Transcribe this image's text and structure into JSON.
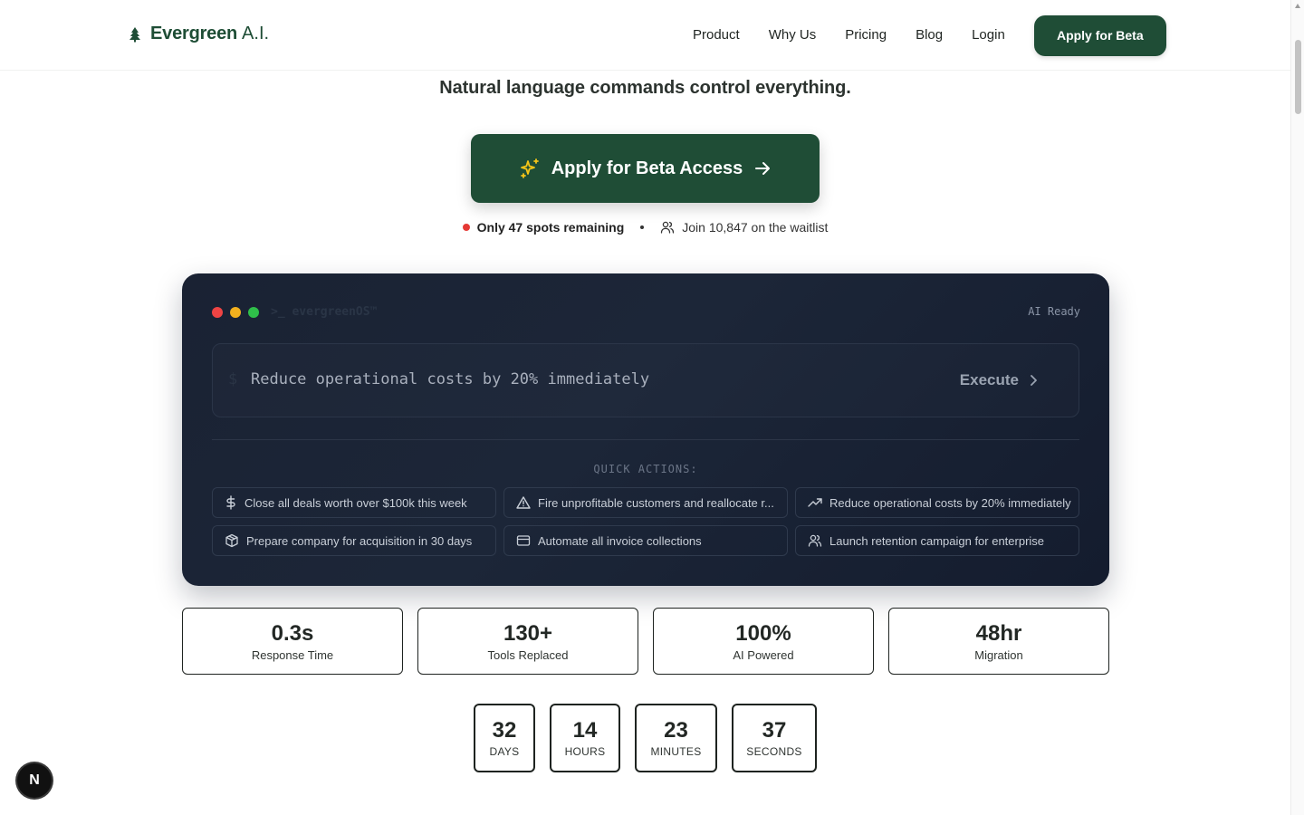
{
  "header": {
    "logo_name": "Evergreen",
    "logo_suffix": "A.I.",
    "nav": [
      "Product",
      "Why Us",
      "Pricing",
      "Blog",
      "Login"
    ],
    "cta_label": "Apply for Beta"
  },
  "hero": {
    "tagline": "Natural language commands control everything.",
    "cta_label": "Apply for Beta Access",
    "spots_text": "Only 47 spots remaining",
    "waitlist_text": "Join 10,847 on the waitlist"
  },
  "terminal": {
    "title": ">_ evergreenOS™",
    "status": "AI Ready",
    "prompt_symbol": "$",
    "command": "Reduce operational costs by 20% immediately",
    "execute_label": "Execute",
    "quick_actions_label": "QUICK ACTIONS:",
    "quick_actions": [
      {
        "icon": "dollar-icon",
        "label": "Close all deals worth over $100k this week"
      },
      {
        "icon": "warning-icon",
        "label": "Fire unprofitable customers and reallocate r..."
      },
      {
        "icon": "trending-up-icon",
        "label": "Reduce operational costs by 20% immediately"
      },
      {
        "icon": "package-icon",
        "label": "Prepare company for acquisition in 30 days"
      },
      {
        "icon": "credit-card-icon",
        "label": "Automate all invoice collections"
      },
      {
        "icon": "users-icon",
        "label": "Launch retention campaign for enterprise"
      }
    ]
  },
  "stats": [
    {
      "value": "0.3s",
      "label": "Response Time"
    },
    {
      "value": "130+",
      "label": "Tools Replaced"
    },
    {
      "value": "100%",
      "label": "AI Powered"
    },
    {
      "value": "48hr",
      "label": "Migration"
    }
  ],
  "countdown": [
    {
      "value": "32",
      "label": "DAYS"
    },
    {
      "value": "14",
      "label": "HOURS"
    },
    {
      "value": "23",
      "label": "MINUTES"
    },
    {
      "value": "37",
      "label": "SECONDS"
    }
  ],
  "dev_badge": "N",
  "colors": {
    "brand": "#1f4d36",
    "terminal_bg": "#1a2233",
    "red": "#e53935",
    "yellow": "#f2b01e",
    "green": "#2fbf4a"
  }
}
